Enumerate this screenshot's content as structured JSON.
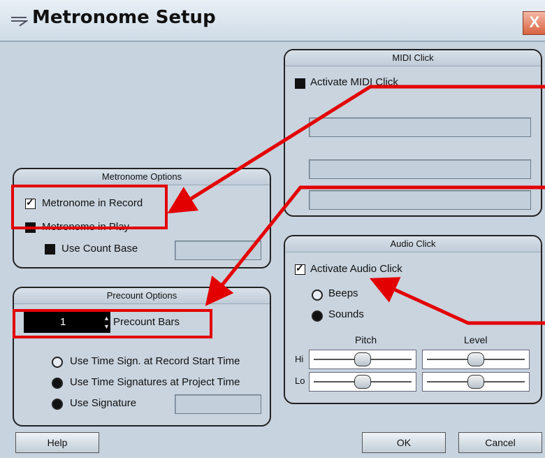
{
  "window": {
    "title": "Metronome Setup",
    "close_label": "X"
  },
  "midi_click": {
    "header": "MIDI Click",
    "activate_label": "Activate MIDI Click",
    "activate_checked": false
  },
  "metronome_options": {
    "header": "Metronome Options",
    "in_record_label": "Metronome in Record",
    "in_record_checked": true,
    "in_play_label": "Metronome in Play",
    "in_play_checked": false,
    "count_base_label": "Use Count Base",
    "count_base_checked": false
  },
  "audio_click": {
    "header": "Audio Click",
    "activate_label": "Activate Audio Click",
    "activate_checked": true,
    "beeps_label": "Beeps",
    "sounds_label": "Sounds",
    "selected": "Sounds",
    "pitch_label": "Pitch",
    "level_label": "Level",
    "hi_label": "Hi",
    "lo_label": "Lo"
  },
  "precount_options": {
    "header": "Precount Options",
    "bars_value": "1",
    "bars_label": "Precount Bars",
    "opt_start_label": "Use Time Sign. at Record Start Time",
    "opt_project_label": "Use Time Signatures at Project Time",
    "opt_signature_label": "Use Signature",
    "selected": "Use Time Signatures at Project Time"
  },
  "buttons": {
    "help": "Help",
    "ok": "OK",
    "cancel": "Cancel"
  },
  "colors": {
    "annotation": "#e30000",
    "panel_bg": "#c9d4df",
    "dialog_bg": "#c7d3df"
  },
  "icons": {
    "close": "close-icon",
    "menu": "window-menu-icon",
    "spin": "spin-arrows-icon"
  }
}
